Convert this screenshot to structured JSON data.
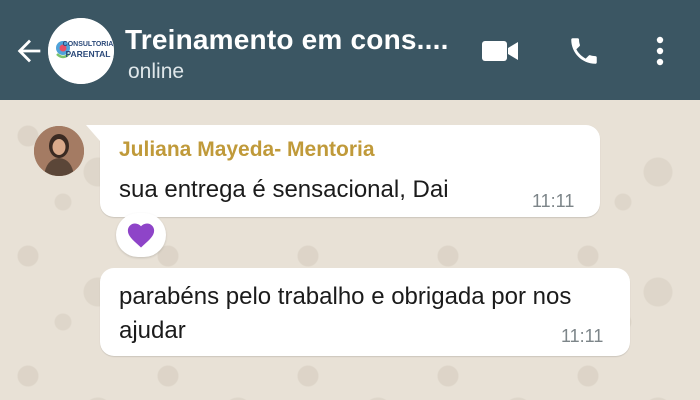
{
  "header": {
    "title": "Treinamento em cons....",
    "status": "online",
    "group_avatar_text_top": "CONSULTORIA",
    "group_avatar_text_bottom": "PARENTAL",
    "background_color": "#3b5663",
    "icons": [
      "back-arrow-icon",
      "video-call-icon",
      "phone-icon",
      "more-vertical-icon"
    ]
  },
  "messages": [
    {
      "sender": "Juliana Mayeda- Mentoria",
      "text": "sua entrega é sensacional, Dai",
      "time": "11:11",
      "reaction": "purple-heart-icon"
    },
    {
      "text": "parabéns pelo trabalho e obrigada por nos ajudar",
      "time": "11:11"
    }
  ],
  "colors": {
    "sender_name": "#c09a3a",
    "chat_background": "#e8e1d6",
    "reaction_heart": "#8e44c8"
  }
}
